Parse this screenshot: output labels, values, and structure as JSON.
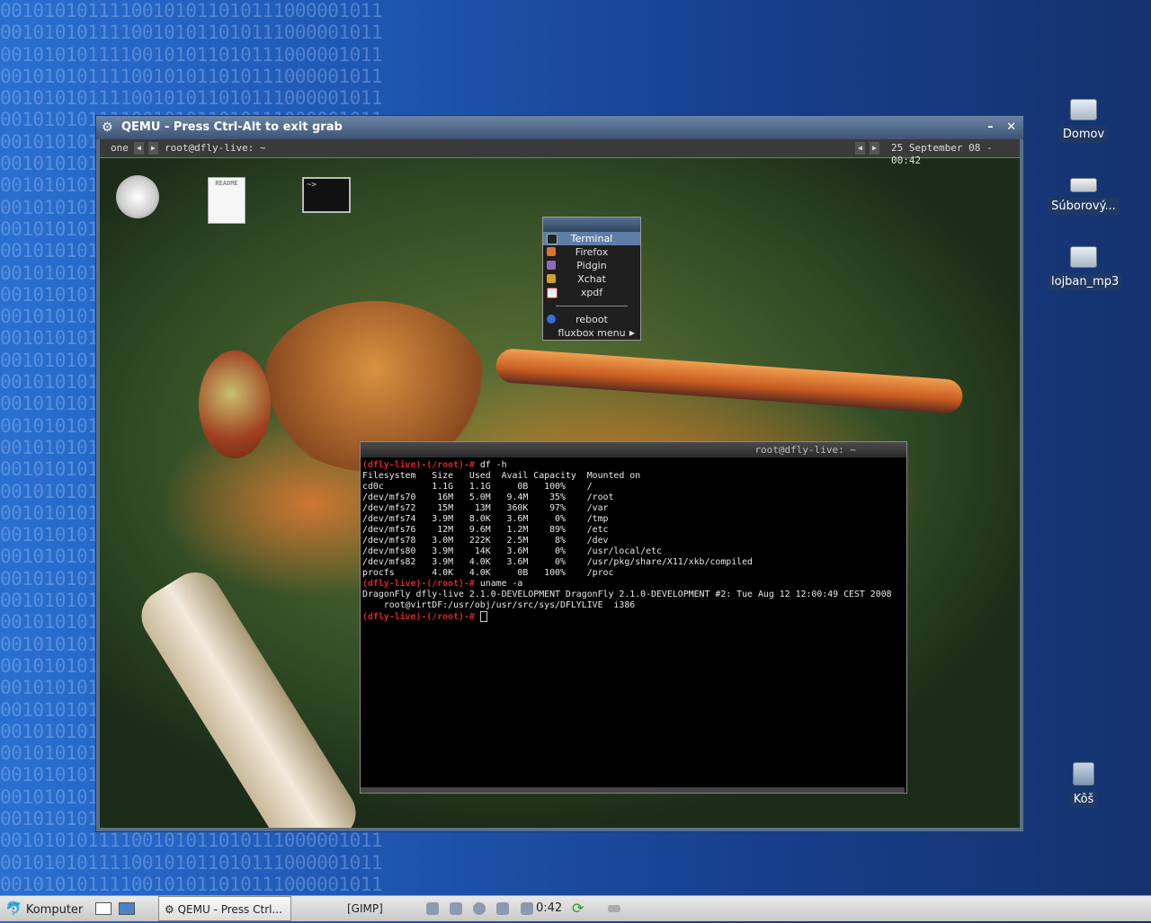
{
  "host": {
    "window_title": "QEMU - Press Ctrl-Alt to exit grab",
    "window_buttons": {
      "minimize": "–",
      "close": "✕"
    },
    "desktop_icons": [
      {
        "label": "Domov"
      },
      {
        "label": "Súborový..."
      },
      {
        "label": "lojban_mp3"
      },
      {
        "label": "Kôš"
      }
    ],
    "background_pattern": "00101010111100101011010111000001011",
    "taskbar": {
      "menu_label": "Komputer",
      "task_active": "QEMU - Press Ctrl...",
      "task_other": "[GIMP]",
      "clock": "0:42"
    }
  },
  "guest": {
    "toolbar": {
      "workspace": "one",
      "window": "root@dfly-live: ~",
      "clock": "25 September 08 - 00:42"
    },
    "icons": {
      "readme": "README",
      "terminal": "~>"
    },
    "menu": {
      "items": [
        "Terminal",
        "Firefox",
        "Pidgin",
        "Xchat",
        "xpdf"
      ],
      "reboot": "reboot",
      "fluxbox": "fluxbox menu"
    },
    "terminal": {
      "title": "root@dfly-live: ~",
      "prompt": "(dfly-live)-(/root)-#",
      "cmd1": "df -h",
      "df_output": "Filesystem   Size   Used  Avail Capacity  Mounted on\ncd0c         1.1G   1.1G     0B   100%    /\n/dev/mfs70    16M   5.0M   9.4M    35%    /root\n/dev/mfs72    15M    13M   360K    97%    /var\n/dev/mfs74   3.9M   8.0K   3.6M     0%    /tmp\n/dev/mfs76    12M   9.6M   1.2M    89%    /etc\n/dev/mfs78   3.0M   222K   2.5M     8%    /dev\n/dev/mfs80   3.9M    14K   3.6M     0%    /usr/local/etc\n/dev/mfs82   3.9M   4.0K   3.6M     0%    /usr/pkg/share/X11/xkb/compiled\nprocfs       4.0K   4.0K     0B   100%    /proc",
      "cmd2": "uname -a",
      "uname_output": "DragonFly dfly-live 2.1.0-DEVELOPMENT DragonFly 2.1.0-DEVELOPMENT #2: Tue Aug 12 12:00:49 CEST 2008\n    root@virtDF:/usr/obj/usr/src/sys/DFLYLIVE  i386"
    }
  },
  "colors": {
    "accent": "#5f7ea6",
    "prompt": "#dd2222"
  }
}
